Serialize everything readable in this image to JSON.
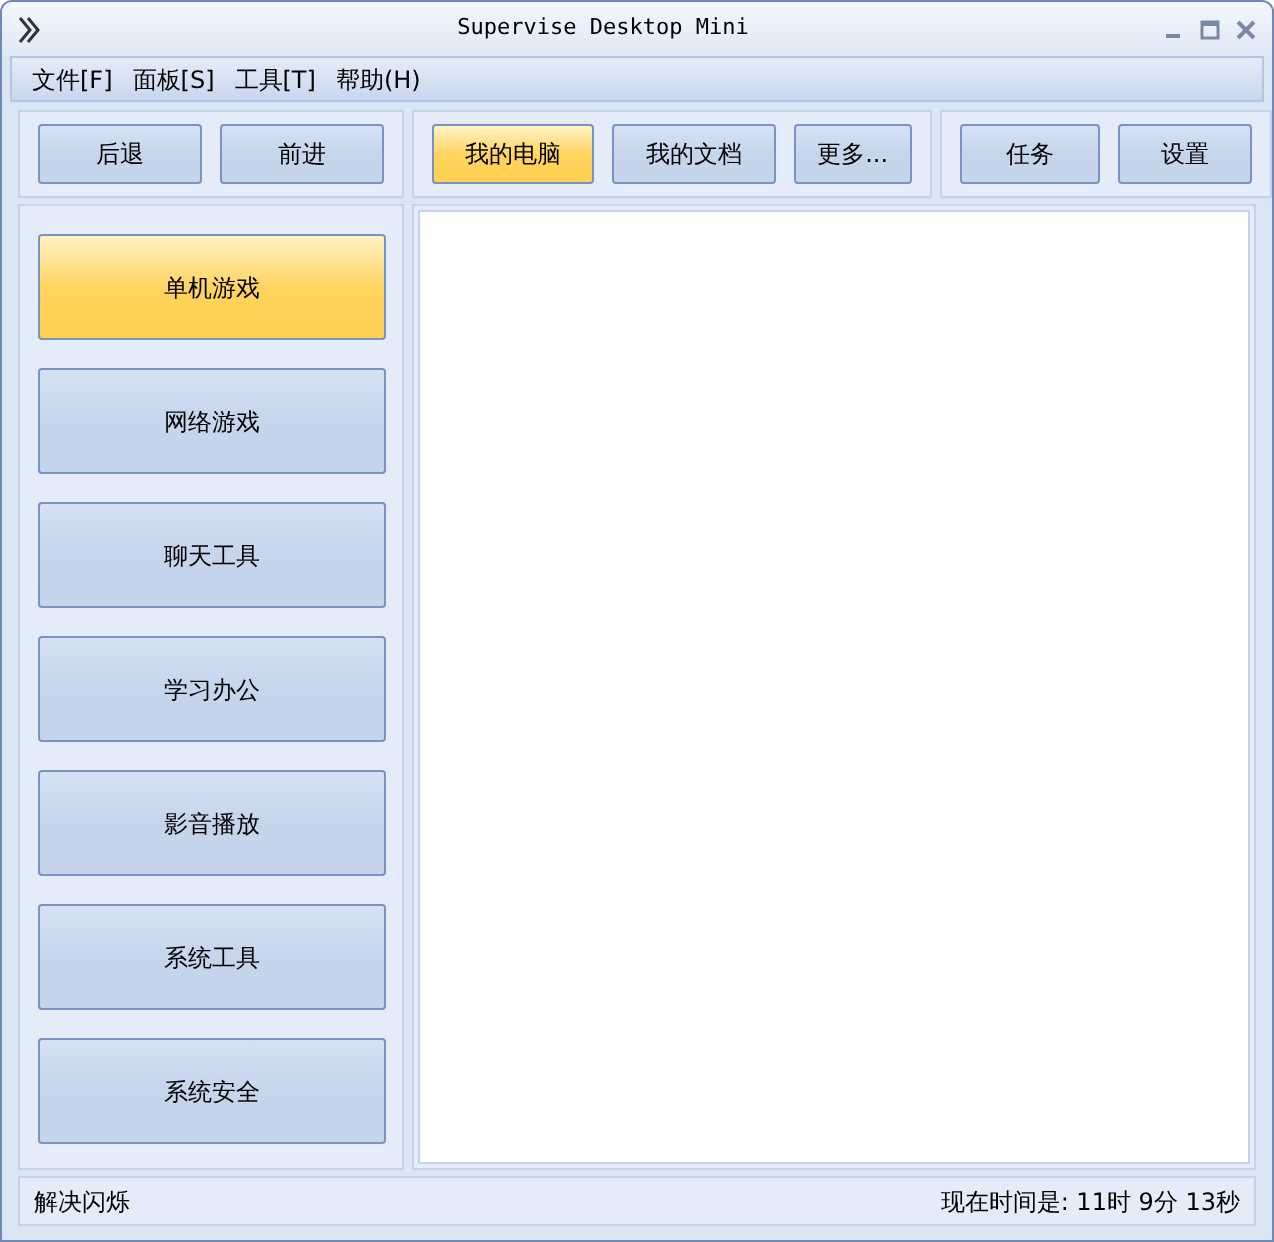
{
  "window": {
    "title": "Supervise Desktop Mini"
  },
  "menu": [
    "文件[F]",
    "面板[S]",
    "工具[T]",
    "帮助(H)"
  ],
  "toolbar_groups": [
    [
      {
        "label": "后退",
        "selected": false
      },
      {
        "label": "前进",
        "selected": false
      }
    ],
    [
      {
        "label": "我的电脑",
        "selected": true
      },
      {
        "label": "我的文档",
        "selected": false
      },
      {
        "label": "更多...",
        "selected": false
      }
    ],
    [
      {
        "label": "任务",
        "selected": false
      },
      {
        "label": "设置",
        "selected": false
      }
    ]
  ],
  "sidebar": {
    "items": [
      {
        "label": "单机游戏",
        "selected": true
      },
      {
        "label": "网络游戏",
        "selected": false
      },
      {
        "label": "聊天工具",
        "selected": false
      },
      {
        "label": "学习办公",
        "selected": false
      },
      {
        "label": "影音播放",
        "selected": false
      },
      {
        "label": "系统工具",
        "selected": false
      },
      {
        "label": "系统安全",
        "selected": false
      }
    ]
  },
  "status_bar": {
    "left": "解决闪烁",
    "right": "现在时间是: 11时 9分 13秒"
  }
}
